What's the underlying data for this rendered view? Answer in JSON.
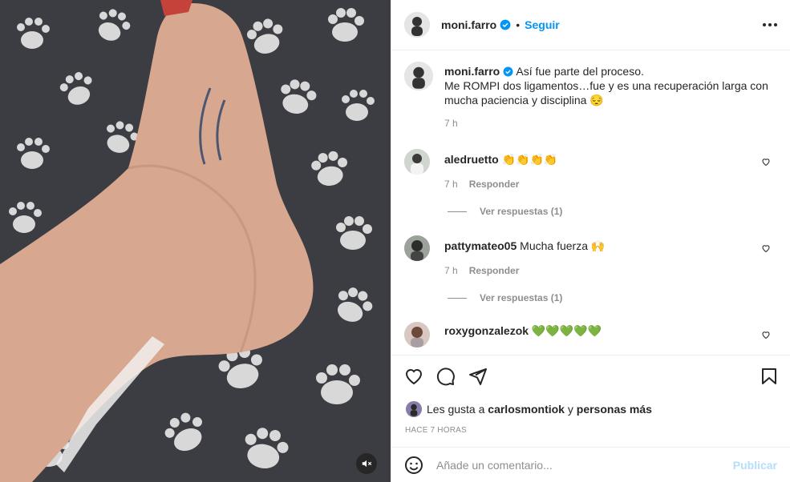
{
  "post": {
    "username": "moni.farro",
    "follow_label": "Seguir",
    "dot": "•"
  },
  "caption": {
    "username": "moni.farro",
    "line1": "Así fue parte del proceso.",
    "line2": "Me ROMPI dos ligamentos…fue y es una recuperación larga con",
    "line3": "mucha paciencia y disciplina 😔",
    "time": "7 h"
  },
  "comments": [
    {
      "username": "aledruetto",
      "text": "👏👏👏👏",
      "time": "7 h",
      "reply_label": "Responder",
      "view_replies": "Ver respuestas (1)"
    },
    {
      "username": "pattymateo05",
      "text": "Mucha fuerza 🙌",
      "time": "7 h",
      "reply_label": "Responder",
      "view_replies": "Ver respuestas (1)"
    },
    {
      "username": "roxygonzalezok",
      "text": "💚💚💚💚💚"
    }
  ],
  "likes": {
    "prefix": "Les gusta a",
    "user": "carlosmontiok",
    "connector": "y",
    "others": "personas más"
  },
  "timestamp": "HACE 7 HORAS",
  "add_comment": {
    "placeholder": "Añade un comentario...",
    "publish_label": "Publicar"
  },
  "colors": {
    "link": "#0095f6",
    "publish_disabled": "#b2dffc",
    "muted": "#8e8e8e",
    "verified": "#0095f6"
  },
  "icons": [
    "mute-icon",
    "verified-icon",
    "more-options-icon",
    "heart-icon",
    "comment-icon",
    "share-icon",
    "bookmark-icon",
    "emoji-icon"
  ]
}
